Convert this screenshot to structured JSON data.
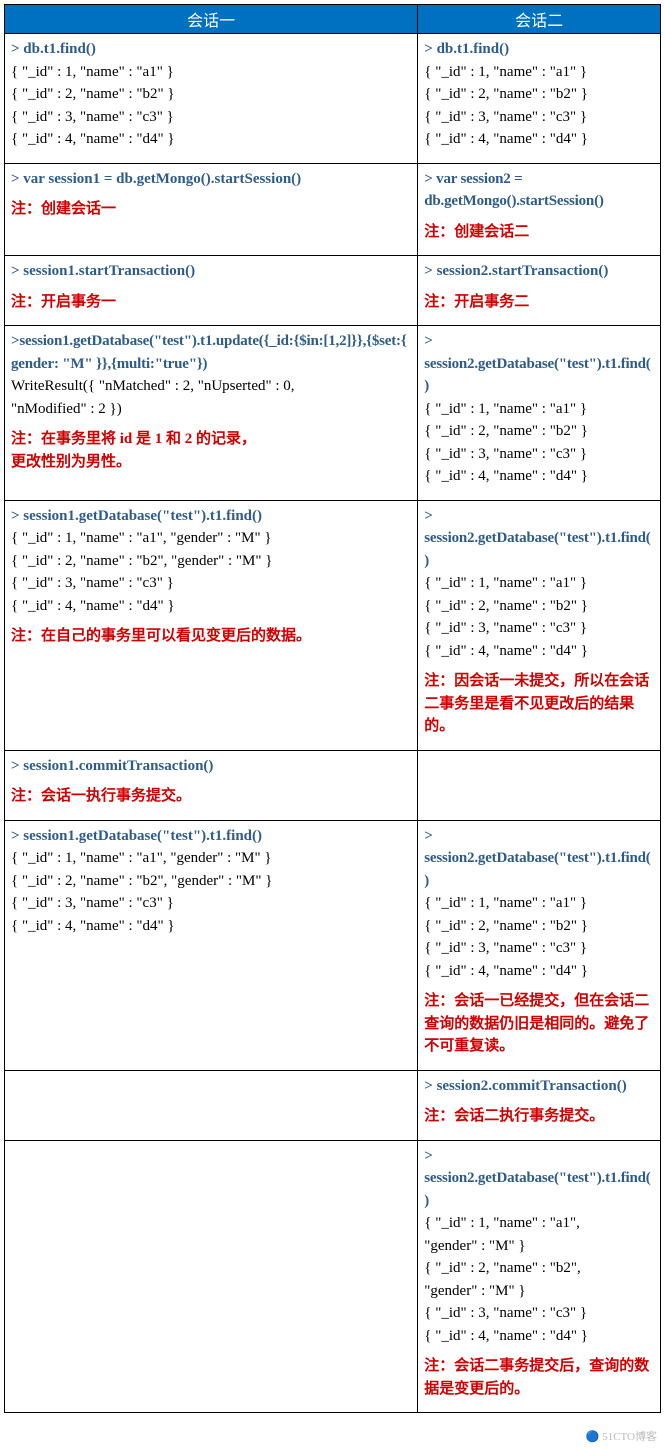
{
  "headers": {
    "col1": "会话一",
    "col2": "会话二"
  },
  "rows": [
    {
      "c1": {
        "cmd": "> db.t1.find()",
        "out": [
          "{ \"_id\" : 1, \"name\" : \"a1\" }",
          "{ \"_id\" : 2, \"name\" : \"b2\" }",
          "{ \"_id\" : 3, \"name\" : \"c3\" }",
          "{ \"_id\" : 4, \"name\" : \"d4\" }"
        ]
      },
      "c2": {
        "cmd": "> db.t1.find()",
        "out": [
          "{ \"_id\" : 1, \"name\" : \"a1\" }",
          "{ \"_id\" : 2, \"name\" : \"b2\" }",
          "{ \"_id\" : 3, \"name\" : \"c3\" }",
          "{ \"_id\" : 4, \"name\" : \"d4\" }"
        ]
      }
    },
    {
      "c1": {
        "cmd": "> var session1 = db.getMongo().startSession()",
        "note": "注：创建会话一"
      },
      "c2": {
        "cmd_lines": [
          "> var session2 =",
          "db.getMongo().startSession()"
        ],
        "note": "注：创建会话二"
      }
    },
    {
      "c1": {
        "cmd": "> session1.startTransaction()",
        "note": "注：开启事务一"
      },
      "c2": {
        "cmd": "> session2.startTransaction()",
        "note": "注：开启事务二"
      }
    },
    {
      "c1": {
        "cmd_lines": [
          ">session1.getDatabase(\"test\").t1.update({_id:{$in:[1,2]}},{$set:{ gender: \"M\" }},{multi:\"true\"})"
        ],
        "out": [
          "WriteResult({ \"nMatched\" : 2, \"nUpserted\" : 0,",
          "     \"nModified\" : 2 })"
        ],
        "note_lines": [
          "注：在事务里将 id 是 1 和 2 的记录，",
          "更改性别为男性。"
        ]
      },
      "c2": {
        "cmd_lines": [
          ">",
          "session2.getDatabase(\"test\").t1.find()"
        ],
        "out": [
          "{ \"_id\" : 1, \"name\" : \"a1\" }",
          "{ \"_id\" : 2, \"name\" : \"b2\" }",
          "{ \"_id\" : 3, \"name\" : \"c3\" }",
          "{ \"_id\" : 4, \"name\" : \"d4\" }"
        ]
      }
    },
    {
      "c1": {
        "cmd": "> session1.getDatabase(\"test\").t1.find()",
        "out": [
          "{ \"_id\" : 1, \"name\" : \"a1\", \"gender\" : \"M\" }",
          "{ \"_id\" : 2, \"name\" : \"b2\", \"gender\" : \"M\" }",
          "{ \"_id\" : 3, \"name\" : \"c3\" }",
          "{ \"_id\" : 4, \"name\" : \"d4\" }"
        ],
        "note": "注：在自己的事务里可以看见变更后的数据。"
      },
      "c2": {
        "cmd_lines": [
          ">",
          "session2.getDatabase(\"test\").t1.find()"
        ],
        "out": [
          "{ \"_id\" : 1, \"name\" : \"a1\" }",
          "{ \"_id\" : 2, \"name\" : \"b2\" }",
          "{ \"_id\" : 3, \"name\" : \"c3\" }",
          "{ \"_id\" : 4, \"name\" : \"d4\" }"
        ],
        "note_lines": [
          "注：因会话一未提交，所以在会话二事务里是看不见更改后的结果的。"
        ]
      }
    },
    {
      "c1": {
        "cmd": "> session1.commitTransaction()",
        "note": "注：会话一执行事务提交。"
      },
      "c2": {
        "empty": true
      }
    },
    {
      "c1": {
        "cmd": "> session1.getDatabase(\"test\").t1.find()",
        "out": [
          "{ \"_id\" : 1, \"name\" : \"a1\", \"gender\" : \"M\" }",
          "{ \"_id\" : 2, \"name\" : \"b2\", \"gender\" : \"M\" }",
          "{ \"_id\" : 3, \"name\" : \"c3\" }",
          "{ \"_id\" : 4, \"name\" : \"d4\" }"
        ]
      },
      "c2": {
        "cmd_lines": [
          ">",
          "session2.getDatabase(\"test\").t1.find()"
        ],
        "out": [
          "{ \"_id\" : 1, \"name\" : \"a1\" }",
          "{ \"_id\" : 2, \"name\" : \"b2\" }",
          "{ \"_id\" : 3, \"name\" : \"c3\" }",
          "{ \"_id\" : 4, \"name\" : \"d4\" }"
        ],
        "note_lines": [
          "注：会话一已经提交，但在会话二查询的数据仍旧是相同的。避免了不可重复读。"
        ]
      }
    },
    {
      "c1": {
        "empty": true
      },
      "c2": {
        "cmd": "> session2.commitTransaction()",
        "note": "注：会话二执行事务提交。"
      }
    },
    {
      "c1": {
        "empty": true
      },
      "c2": {
        "cmd_lines": [
          ">",
          "session2.getDatabase(\"test\").t1.find()"
        ],
        "out": [
          "{ \"_id\" : 1, \"name\" : \"a1\",",
          "\"gender\" : \"M\" }",
          "{ \"_id\" : 2, \"name\" : \"b2\",",
          "\"gender\" : \"M\" }",
          "{ \"_id\" : 3, \"name\" : \"c3\" }",
          "{ \"_id\" : 4, \"name\" : \"d4\" }"
        ],
        "note_lines": [
          "注：会话二事务提交后，查询的数据是变更后的。"
        ]
      }
    }
  ],
  "watermark": "🔵 51CTO博客"
}
